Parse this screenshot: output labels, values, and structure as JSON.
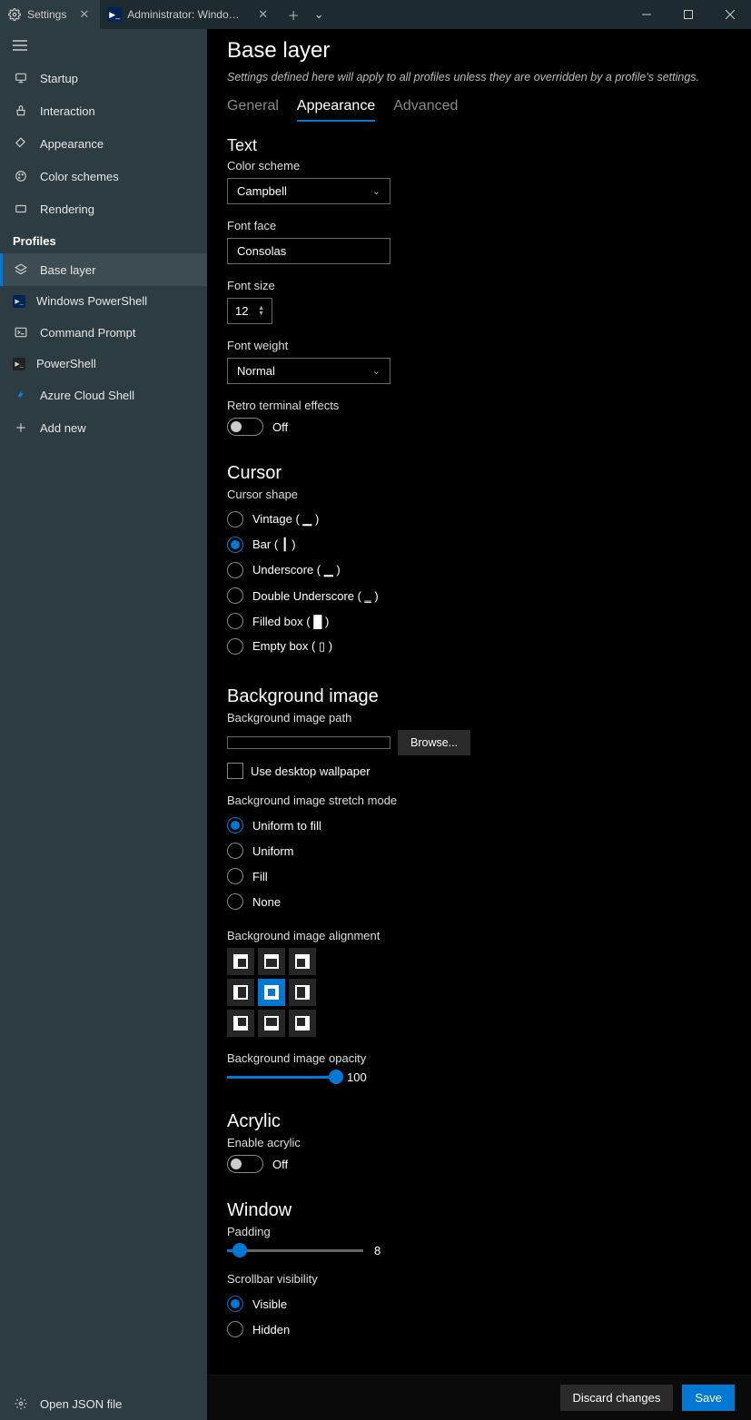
{
  "tabs": [
    {
      "label": "Settings",
      "active": true
    },
    {
      "label": "Administrator: Windows PowerS",
      "active": false
    }
  ],
  "sidebar": {
    "items": [
      {
        "label": "Startup"
      },
      {
        "label": "Interaction"
      },
      {
        "label": "Appearance"
      },
      {
        "label": "Color schemes"
      },
      {
        "label": "Rendering"
      }
    ],
    "profilesHeader": "Profiles",
    "profiles": [
      {
        "label": "Base layer"
      },
      {
        "label": "Windows PowerShell"
      },
      {
        "label": "Command Prompt"
      },
      {
        "label": "PowerShell"
      },
      {
        "label": "Azure Cloud Shell"
      },
      {
        "label": "Add new"
      }
    ],
    "footer": "Open JSON file"
  },
  "page": {
    "title": "Base layer",
    "description": "Settings defined here will apply to all profiles unless they are overridden by a profile's settings.",
    "subtabs": [
      "General",
      "Appearance",
      "Advanced"
    ],
    "activeSubtab": "Appearance"
  },
  "text": {
    "header": "Text",
    "colorSchemeLabel": "Color scheme",
    "colorScheme": "Campbell",
    "fontFaceLabel": "Font face",
    "fontFace": "Consolas",
    "fontSizeLabel": "Font size",
    "fontSize": "12",
    "fontWeightLabel": "Font weight",
    "fontWeight": "Normal",
    "retroLabel": "Retro terminal effects",
    "retroState": "Off"
  },
  "cursor": {
    "header": "Cursor",
    "shapeLabel": "Cursor shape",
    "options": [
      "Vintage ( ▁ )",
      "Bar ( ┃ )",
      "Underscore ( ▁ )",
      "Double Underscore ( ‗ )",
      "Filled box ( █ )",
      "Empty box ( ▯ )"
    ],
    "selectedIndex": 1
  },
  "bg": {
    "header": "Background image",
    "pathLabel": "Background image path",
    "path": "",
    "browse": "Browse...",
    "useDesktop": "Use desktop wallpaper",
    "stretchLabel": "Background image stretch mode",
    "stretchOptions": [
      "Uniform to fill",
      "Uniform",
      "Fill",
      "None"
    ],
    "stretchSelected": 0,
    "alignLabel": "Background image alignment",
    "opacityLabel": "Background image opacity",
    "opacityValue": "100"
  },
  "acrylic": {
    "header": "Acrylic",
    "enableLabel": "Enable acrylic",
    "state": "Off"
  },
  "window": {
    "header": "Window",
    "paddingLabel": "Padding",
    "paddingValue": "8",
    "scrollLabel": "Scrollbar visibility",
    "scrollOptions": [
      "Visible",
      "Hidden"
    ],
    "scrollSelected": 0
  },
  "footer": {
    "discard": "Discard changes",
    "save": "Save"
  }
}
